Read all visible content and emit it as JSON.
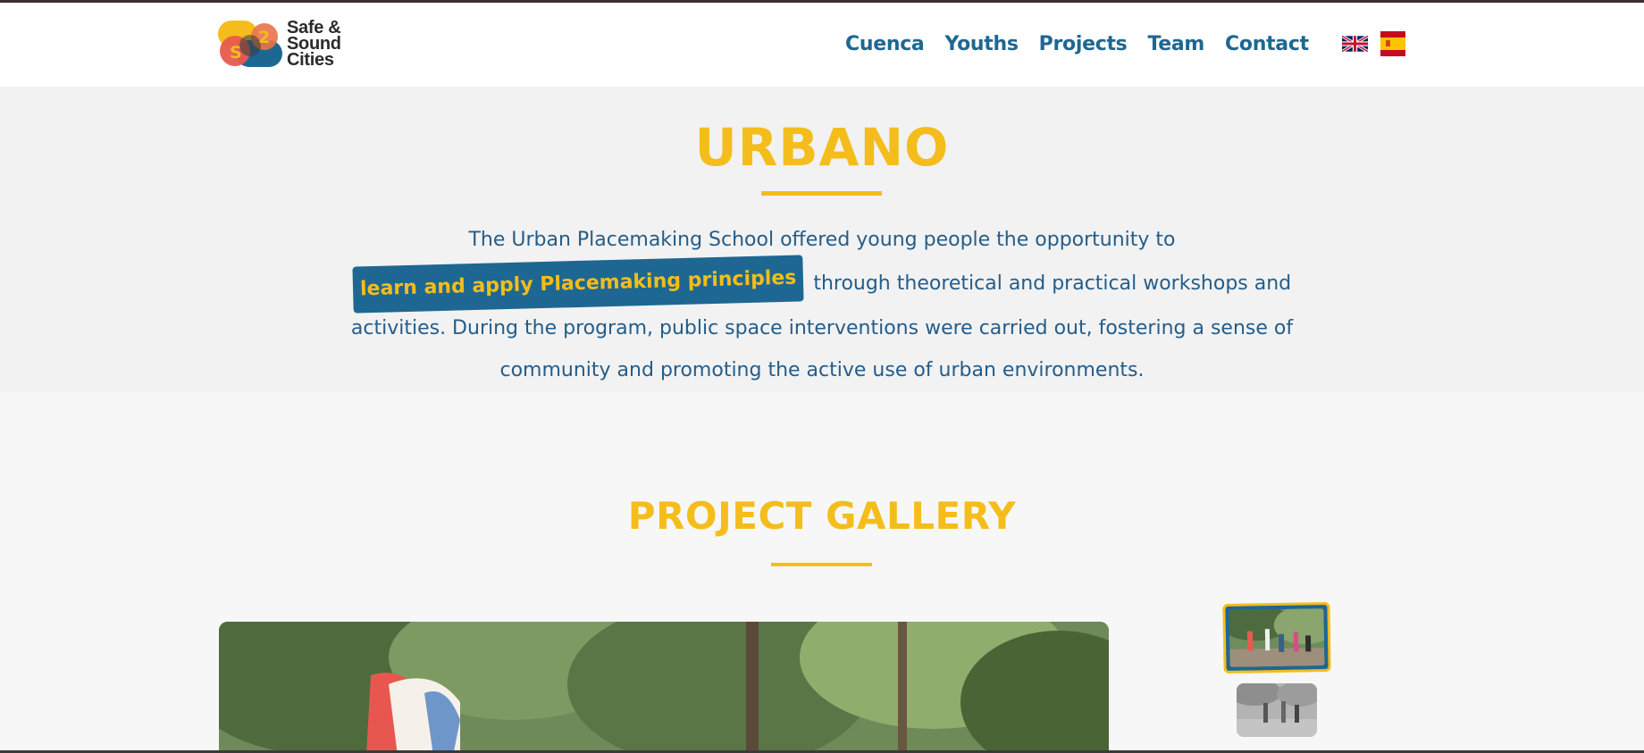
{
  "header": {
    "logo": {
      "mark_text": "S2",
      "lines": [
        "Safe &",
        "Sound",
        "Cities"
      ]
    },
    "nav": [
      {
        "label": "Cuenca"
      },
      {
        "label": "Youths"
      },
      {
        "label": "Projects"
      },
      {
        "label": "Team"
      },
      {
        "label": "Contact"
      }
    ],
    "languages": [
      {
        "icon": "uk-flag-icon"
      },
      {
        "icon": "spain-flag-icon"
      }
    ]
  },
  "intro": {
    "title": "URBANO",
    "text_before": "The Urban Placemaking School offered young people the opportunity to",
    "highlight": "learn and apply Placemaking principles",
    "text_after": "through theoretical and practical workshops and activities. During the program, public space interventions were carried out, fostering a sense of community and promoting the active use of urban environments."
  },
  "gallery": {
    "title": "PROJECT GALLERY"
  },
  "colors": {
    "accent_yellow": "#f4bd1b",
    "brand_blue": "#1e6792",
    "text_blue": "#245d8a"
  }
}
